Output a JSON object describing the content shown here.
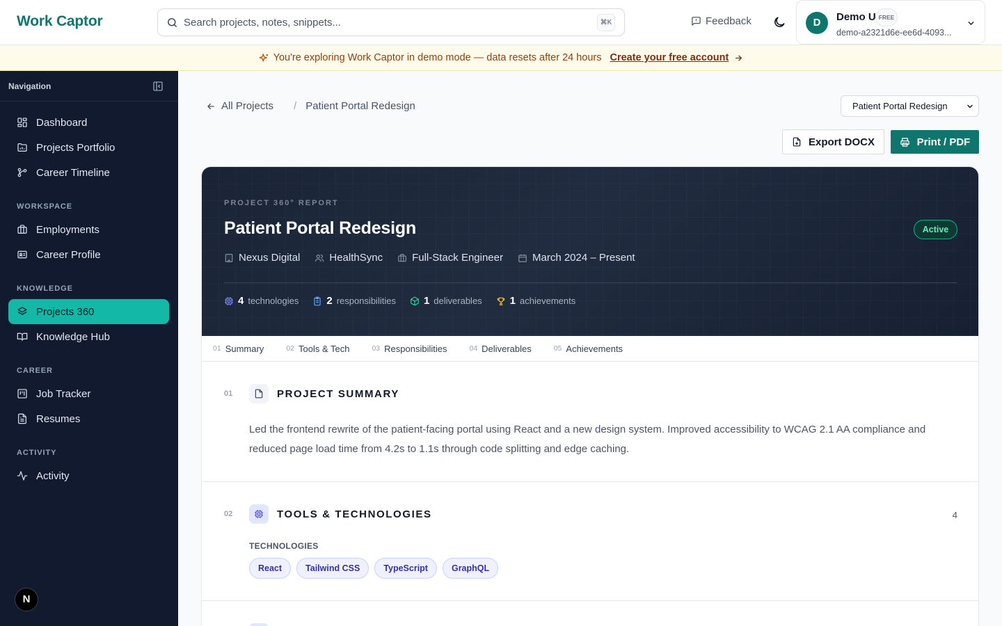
{
  "app": {
    "name": "Work Captor"
  },
  "topbar": {
    "search_placeholder": "Search projects, notes, snippets...",
    "search_shortcut": "⌘K",
    "feedback_label": "Feedback",
    "user": {
      "initial": "D",
      "name": "Demo User",
      "plan": "FREE",
      "id": "demo-a2321d6e-ee6d-4093..."
    }
  },
  "banner": {
    "message": "You're exploring Work Captor in demo mode — data resets after 24 hours",
    "cta": "Create your free account"
  },
  "sidebar": {
    "header": "Navigation",
    "top_items": [
      {
        "label": "Dashboard",
        "icon": "dashboard-icon"
      },
      {
        "label": "Projects Portfolio",
        "icon": "portfolio-icon"
      },
      {
        "label": "Career Timeline",
        "icon": "timeline-icon"
      }
    ],
    "sections": [
      {
        "title": "WORKSPACE",
        "items": [
          {
            "label": "Employments",
            "icon": "briefcase-icon"
          },
          {
            "label": "Career Profile",
            "icon": "id-card-icon"
          }
        ]
      },
      {
        "title": "KNOWLEDGE",
        "items": [
          {
            "label": "Projects 360",
            "icon": "layers-icon",
            "active": true
          },
          {
            "label": "Knowledge Hub",
            "icon": "book-icon"
          }
        ]
      },
      {
        "title": "CAREER",
        "items": [
          {
            "label": "Job Tracker",
            "icon": "kanban-icon"
          },
          {
            "label": "Resumes",
            "icon": "document-icon"
          }
        ]
      },
      {
        "title": "ACTIVITY",
        "items": [
          {
            "label": "Activity",
            "icon": "activity-icon"
          }
        ]
      }
    ],
    "badge": "N"
  },
  "main": {
    "breadcrumb": {
      "back_label": "All Projects",
      "separator": "/",
      "current": "Patient Portal Redesign"
    },
    "project_select": {
      "selected": "Patient Portal Redesign"
    },
    "actions": {
      "export_label": "Export DOCX",
      "print_label": "Print / PDF"
    },
    "report": {
      "kicker": "PROJECT 360° REPORT",
      "title": "Patient Portal Redesign",
      "status": "Active",
      "meta": [
        {
          "icon": "building-icon",
          "text": "Nexus Digital"
        },
        {
          "icon": "users-icon",
          "text": "HealthSync"
        },
        {
          "icon": "briefcase-icon",
          "text": "Full-Stack Engineer"
        },
        {
          "icon": "calendar-icon",
          "text": "March 2024 – Present"
        }
      ],
      "stats": [
        {
          "icon": "cpu-icon",
          "value": "4",
          "label": "technologies",
          "color": "#818cf8"
        },
        {
          "icon": "clipboard-icon",
          "value": "2",
          "label": "responsibilities",
          "color": "#60a5fa"
        },
        {
          "icon": "package-icon",
          "value": "1",
          "label": "deliverables",
          "color": "#34d399"
        },
        {
          "icon": "trophy-icon",
          "value": "1",
          "label": "achievements",
          "color": "#fbbf24"
        }
      ],
      "tabs": [
        {
          "num": "01",
          "label": "Summary"
        },
        {
          "num": "02",
          "label": "Tools & Tech"
        },
        {
          "num": "03",
          "label": "Responsibilities"
        },
        {
          "num": "04",
          "label": "Deliverables"
        },
        {
          "num": "05",
          "label": "Achievements"
        }
      ],
      "summary": {
        "num": "01",
        "title": "PROJECT SUMMARY",
        "text": "Led the frontend rewrite of the patient-facing portal using React and a new design system. Improved accessibility to WCAG 2.1 AA compliance and reduced page load time from 4.2s to 1.1s through code splitting and edge caching."
      },
      "tools": {
        "num": "02",
        "title": "TOOLS & TECHNOLOGIES",
        "count": "4",
        "group_label": "TECHNOLOGIES",
        "chips": [
          "React",
          "Tailwind CSS",
          "TypeScript",
          "GraphQL"
        ]
      }
    }
  },
  "colors": {
    "brand": "#0f766e",
    "sidebar_bg": "#111a2e",
    "active_nav": "#14b8a6",
    "banner_bg": "#fefbea",
    "hero_bg": "#1a2436",
    "status_green": "#10b981"
  }
}
